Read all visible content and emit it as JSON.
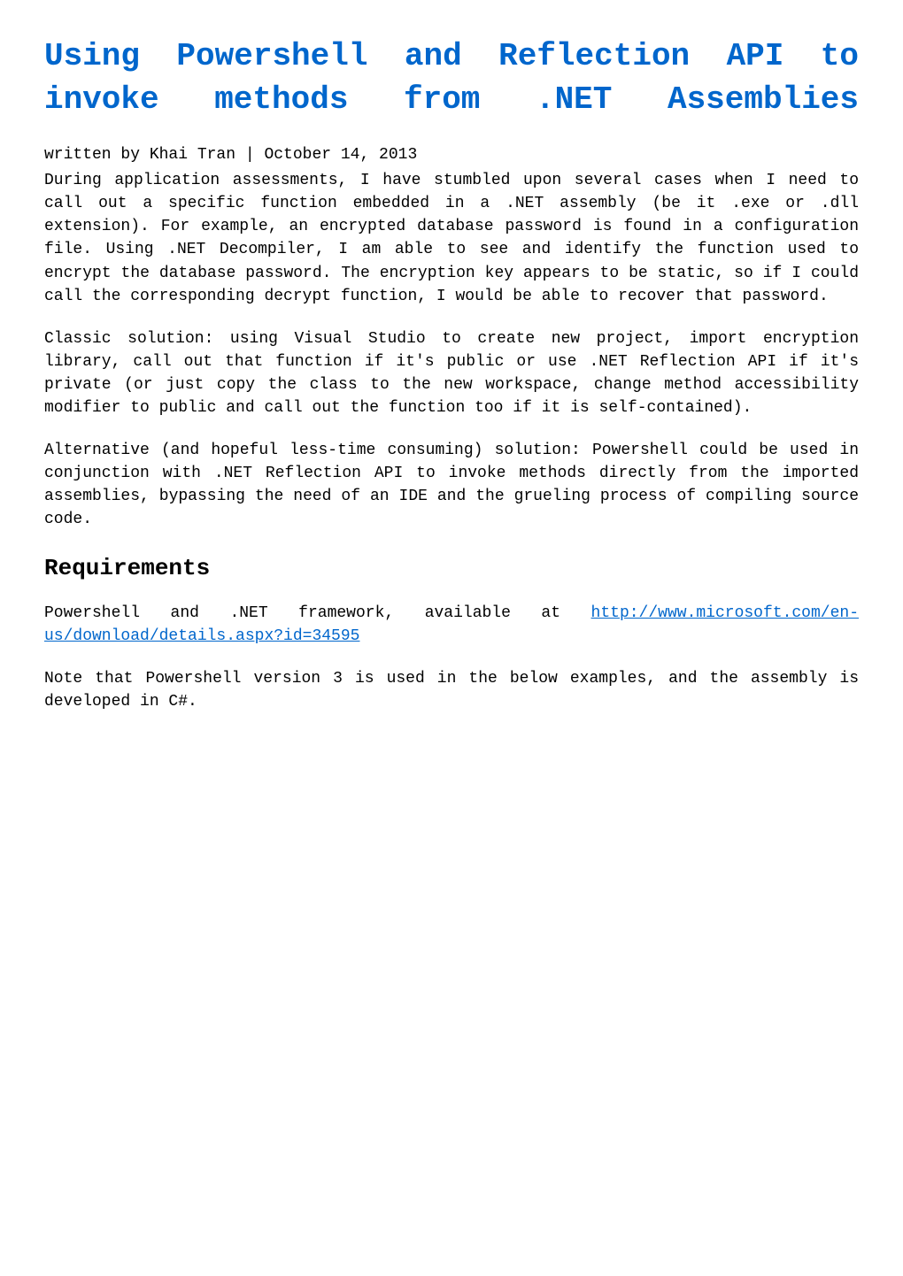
{
  "title": "Using Powershell and Reflection API to invoke methods from .NET Assemblies",
  "byline": "written by Khai Tran | October 14, 2013",
  "paragraphs": {
    "p1": "During application assessments, I have stumbled upon several cases when I need to call out a specific function embedded in a .NET assembly (be it .exe or .dll extension). For example, an encrypted database password is found in a configuration file. Using .NET Decompiler, I am able to see and identify the function used to encrypt the database password. The encryption key appears to be static, so if I could call the corresponding decrypt function, I would be able to recover that password.",
    "p2": "Classic solution: using Visual Studio to create new project, import encryption library, call out that function if it's public or use .NET Reflection API if it's private (or just copy the class to the new workspace, change method accessibility modifier to public and call out the function too if it is self-contained).",
    "p3": "Alternative (and hopeful less-time consuming) solution: Powershell could be used in conjunction with .NET Reflection API to invoke methods directly from the imported assemblies, bypassing the need of an IDE and the grueling process of compiling source code."
  },
  "sections": {
    "requirements": {
      "heading": "Requirements",
      "p1_prefix": "Powershell and .NET framework, available at ",
      "link_text": "http://www.microsoft.com/en-us/download/details.aspx?id=34595",
      "link_href": "http://www.microsoft.com/en-us/download/details.aspx?id=34595",
      "p2": "Note that Powershell version 3 is used in the below examples, and the assembly is developed in C#."
    }
  }
}
